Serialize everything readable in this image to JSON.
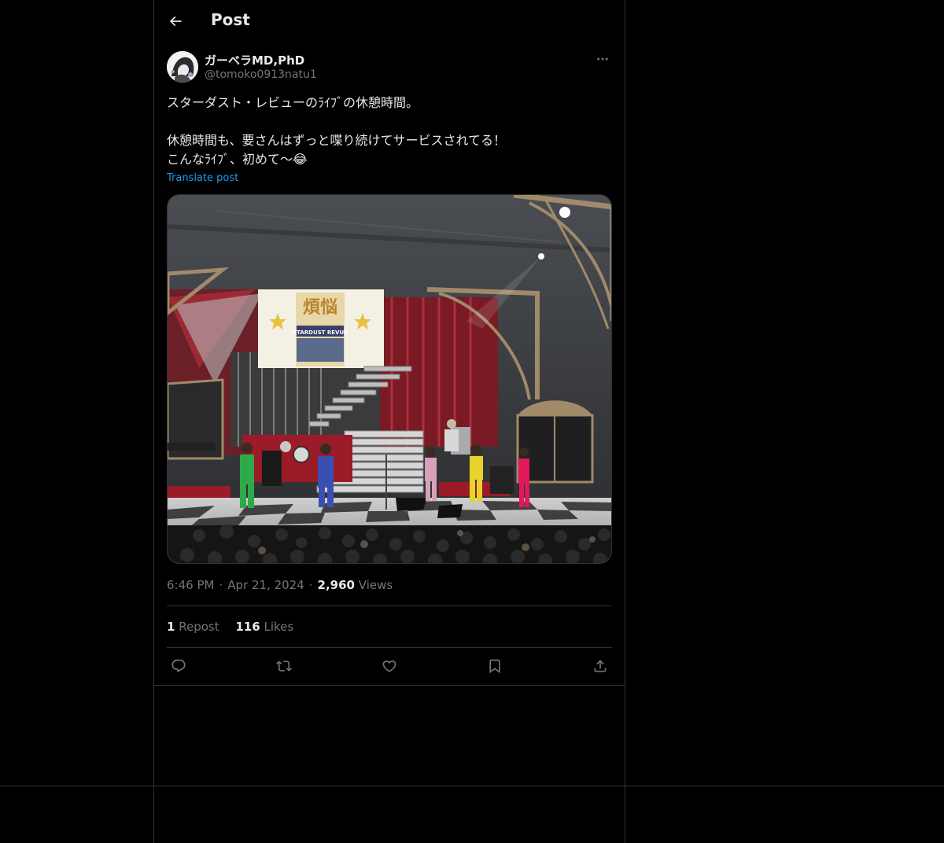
{
  "header": {
    "title": "Post"
  },
  "author": {
    "display_name": "ガーベラMD,PhD",
    "handle": "@tomoko0913natu1"
  },
  "post": {
    "line1": "スターダスト・レビューのﾗｲﾌﾞの休憩時間。",
    "line2": "休憩時間も、要さんはずっと喋り続けてサービスされてる！",
    "line3": "こんなﾗｲﾌﾞ、初めて〜😂",
    "translate_label": "Translate post"
  },
  "media": {
    "screen_text_1": "煩悩",
    "screen_text_2": "STARDUST REVUE"
  },
  "meta": {
    "time": "6:46 PM",
    "date": "Apr 21, 2024",
    "views_count": "2,960",
    "views_label": "Views"
  },
  "stats": {
    "reposts_count": "1",
    "reposts_label": "Repost",
    "likes_count": "116",
    "likes_label": "Likes"
  },
  "icons": {
    "back": "arrow-left-icon",
    "more": "more-horizontal-icon",
    "reply": "reply-icon",
    "repost": "repost-icon",
    "like": "heart-icon",
    "bookmark": "bookmark-icon",
    "share": "share-icon"
  },
  "colors": {
    "background": "#000000",
    "text": "#e7e9ea",
    "secondary": "#71767b",
    "link": "#1d9bf0",
    "border": "#2f3336"
  }
}
